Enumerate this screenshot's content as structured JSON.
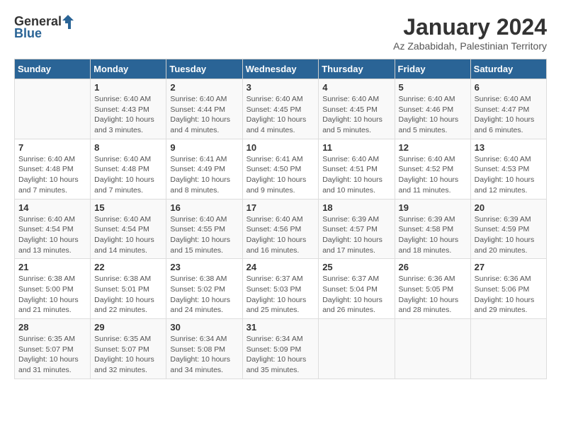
{
  "header": {
    "logo_general": "General",
    "logo_blue": "Blue",
    "month_title": "January 2024",
    "location": "Az Zababidah, Palestinian Territory"
  },
  "columns": [
    "Sunday",
    "Monday",
    "Tuesday",
    "Wednesday",
    "Thursday",
    "Friday",
    "Saturday"
  ],
  "weeks": [
    [
      {
        "day": "",
        "sunrise": "",
        "sunset": "",
        "daylight": ""
      },
      {
        "day": "1",
        "sunrise": "Sunrise: 6:40 AM",
        "sunset": "Sunset: 4:43 PM",
        "daylight": "Daylight: 10 hours and 3 minutes."
      },
      {
        "day": "2",
        "sunrise": "Sunrise: 6:40 AM",
        "sunset": "Sunset: 4:44 PM",
        "daylight": "Daylight: 10 hours and 4 minutes."
      },
      {
        "day": "3",
        "sunrise": "Sunrise: 6:40 AM",
        "sunset": "Sunset: 4:45 PM",
        "daylight": "Daylight: 10 hours and 4 minutes."
      },
      {
        "day": "4",
        "sunrise": "Sunrise: 6:40 AM",
        "sunset": "Sunset: 4:45 PM",
        "daylight": "Daylight: 10 hours and 5 minutes."
      },
      {
        "day": "5",
        "sunrise": "Sunrise: 6:40 AM",
        "sunset": "Sunset: 4:46 PM",
        "daylight": "Daylight: 10 hours and 5 minutes."
      },
      {
        "day": "6",
        "sunrise": "Sunrise: 6:40 AM",
        "sunset": "Sunset: 4:47 PM",
        "daylight": "Daylight: 10 hours and 6 minutes."
      }
    ],
    [
      {
        "day": "7",
        "sunrise": "Sunrise: 6:40 AM",
        "sunset": "Sunset: 4:48 PM",
        "daylight": "Daylight: 10 hours and 7 minutes."
      },
      {
        "day": "8",
        "sunrise": "Sunrise: 6:40 AM",
        "sunset": "Sunset: 4:48 PM",
        "daylight": "Daylight: 10 hours and 7 minutes."
      },
      {
        "day": "9",
        "sunrise": "Sunrise: 6:41 AM",
        "sunset": "Sunset: 4:49 PM",
        "daylight": "Daylight: 10 hours and 8 minutes."
      },
      {
        "day": "10",
        "sunrise": "Sunrise: 6:41 AM",
        "sunset": "Sunset: 4:50 PM",
        "daylight": "Daylight: 10 hours and 9 minutes."
      },
      {
        "day": "11",
        "sunrise": "Sunrise: 6:40 AM",
        "sunset": "Sunset: 4:51 PM",
        "daylight": "Daylight: 10 hours and 10 minutes."
      },
      {
        "day": "12",
        "sunrise": "Sunrise: 6:40 AM",
        "sunset": "Sunset: 4:52 PM",
        "daylight": "Daylight: 10 hours and 11 minutes."
      },
      {
        "day": "13",
        "sunrise": "Sunrise: 6:40 AM",
        "sunset": "Sunset: 4:53 PM",
        "daylight": "Daylight: 10 hours and 12 minutes."
      }
    ],
    [
      {
        "day": "14",
        "sunrise": "Sunrise: 6:40 AM",
        "sunset": "Sunset: 4:54 PM",
        "daylight": "Daylight: 10 hours and 13 minutes."
      },
      {
        "day": "15",
        "sunrise": "Sunrise: 6:40 AM",
        "sunset": "Sunset: 4:54 PM",
        "daylight": "Daylight: 10 hours and 14 minutes."
      },
      {
        "day": "16",
        "sunrise": "Sunrise: 6:40 AM",
        "sunset": "Sunset: 4:55 PM",
        "daylight": "Daylight: 10 hours and 15 minutes."
      },
      {
        "day": "17",
        "sunrise": "Sunrise: 6:40 AM",
        "sunset": "Sunset: 4:56 PM",
        "daylight": "Daylight: 10 hours and 16 minutes."
      },
      {
        "day": "18",
        "sunrise": "Sunrise: 6:39 AM",
        "sunset": "Sunset: 4:57 PM",
        "daylight": "Daylight: 10 hours and 17 minutes."
      },
      {
        "day": "19",
        "sunrise": "Sunrise: 6:39 AM",
        "sunset": "Sunset: 4:58 PM",
        "daylight": "Daylight: 10 hours and 18 minutes."
      },
      {
        "day": "20",
        "sunrise": "Sunrise: 6:39 AM",
        "sunset": "Sunset: 4:59 PM",
        "daylight": "Daylight: 10 hours and 20 minutes."
      }
    ],
    [
      {
        "day": "21",
        "sunrise": "Sunrise: 6:38 AM",
        "sunset": "Sunset: 5:00 PM",
        "daylight": "Daylight: 10 hours and 21 minutes."
      },
      {
        "day": "22",
        "sunrise": "Sunrise: 6:38 AM",
        "sunset": "Sunset: 5:01 PM",
        "daylight": "Daylight: 10 hours and 22 minutes."
      },
      {
        "day": "23",
        "sunrise": "Sunrise: 6:38 AM",
        "sunset": "Sunset: 5:02 PM",
        "daylight": "Daylight: 10 hours and 24 minutes."
      },
      {
        "day": "24",
        "sunrise": "Sunrise: 6:37 AM",
        "sunset": "Sunset: 5:03 PM",
        "daylight": "Daylight: 10 hours and 25 minutes."
      },
      {
        "day": "25",
        "sunrise": "Sunrise: 6:37 AM",
        "sunset": "Sunset: 5:04 PM",
        "daylight": "Daylight: 10 hours and 26 minutes."
      },
      {
        "day": "26",
        "sunrise": "Sunrise: 6:36 AM",
        "sunset": "Sunset: 5:05 PM",
        "daylight": "Daylight: 10 hours and 28 minutes."
      },
      {
        "day": "27",
        "sunrise": "Sunrise: 6:36 AM",
        "sunset": "Sunset: 5:06 PM",
        "daylight": "Daylight: 10 hours and 29 minutes."
      }
    ],
    [
      {
        "day": "28",
        "sunrise": "Sunrise: 6:35 AM",
        "sunset": "Sunset: 5:07 PM",
        "daylight": "Daylight: 10 hours and 31 minutes."
      },
      {
        "day": "29",
        "sunrise": "Sunrise: 6:35 AM",
        "sunset": "Sunset: 5:07 PM",
        "daylight": "Daylight: 10 hours and 32 minutes."
      },
      {
        "day": "30",
        "sunrise": "Sunrise: 6:34 AM",
        "sunset": "Sunset: 5:08 PM",
        "daylight": "Daylight: 10 hours and 34 minutes."
      },
      {
        "day": "31",
        "sunrise": "Sunrise: 6:34 AM",
        "sunset": "Sunset: 5:09 PM",
        "daylight": "Daylight: 10 hours and 35 minutes."
      },
      {
        "day": "",
        "sunrise": "",
        "sunset": "",
        "daylight": ""
      },
      {
        "day": "",
        "sunrise": "",
        "sunset": "",
        "daylight": ""
      },
      {
        "day": "",
        "sunrise": "",
        "sunset": "",
        "daylight": ""
      }
    ]
  ]
}
